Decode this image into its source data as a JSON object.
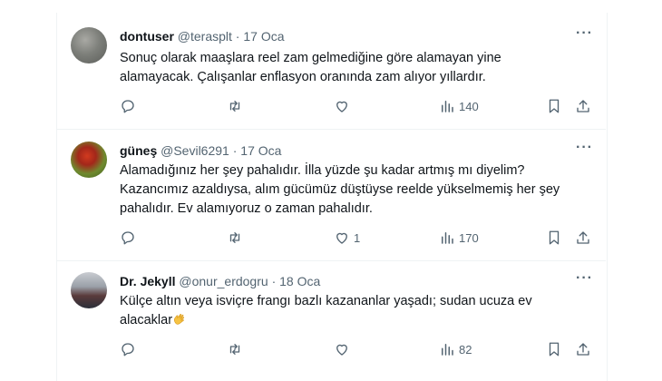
{
  "tweets": [
    {
      "name": "dontuser",
      "handle": "@terasplt",
      "sep": "·",
      "date": "17 Oca",
      "lines": [
        "Sonuç olarak maaşlara reel zam gelmediğine göre alamayan yine",
        "alamayacak. Çalışanlar enflasyon oranında zam alıyor yıllardır."
      ],
      "likes": "",
      "views": "140"
    },
    {
      "name": "güneş",
      "handle": "@Sevil6291",
      "sep": "·",
      "date": "17 Oca",
      "lines": [
        "Alamadığınız her şey pahalıdır. İlla yüzde şu kadar artmış mı diyelim?",
        "Kazancımız azaldıysa, alım gücümüz düştüyse reelde yükselmemiş her şey",
        "pahalıdır. Ev alamıyoruz o zaman pahalıdır."
      ],
      "likes": "1",
      "views": "170"
    },
    {
      "name": "Dr. Jekyll",
      "handle": "@onur_erdogru",
      "sep": "·",
      "date": "18 Oca",
      "lines": [
        "Külçe altın veya isviçre frangı bazlı kazananlar yaşadı; sudan ucuza ev",
        "alacaklar"
      ],
      "likes": "",
      "views": "82"
    }
  ],
  "icons": {
    "reply": "reply-icon",
    "retweet": "retweet-icon",
    "like": "like-icon",
    "views": "views-icon",
    "bookmark": "bookmark-icon",
    "share": "share-icon",
    "more": "more-icon",
    "emoji": "clapping-hands-emoji"
  },
  "more_glyph": "···"
}
